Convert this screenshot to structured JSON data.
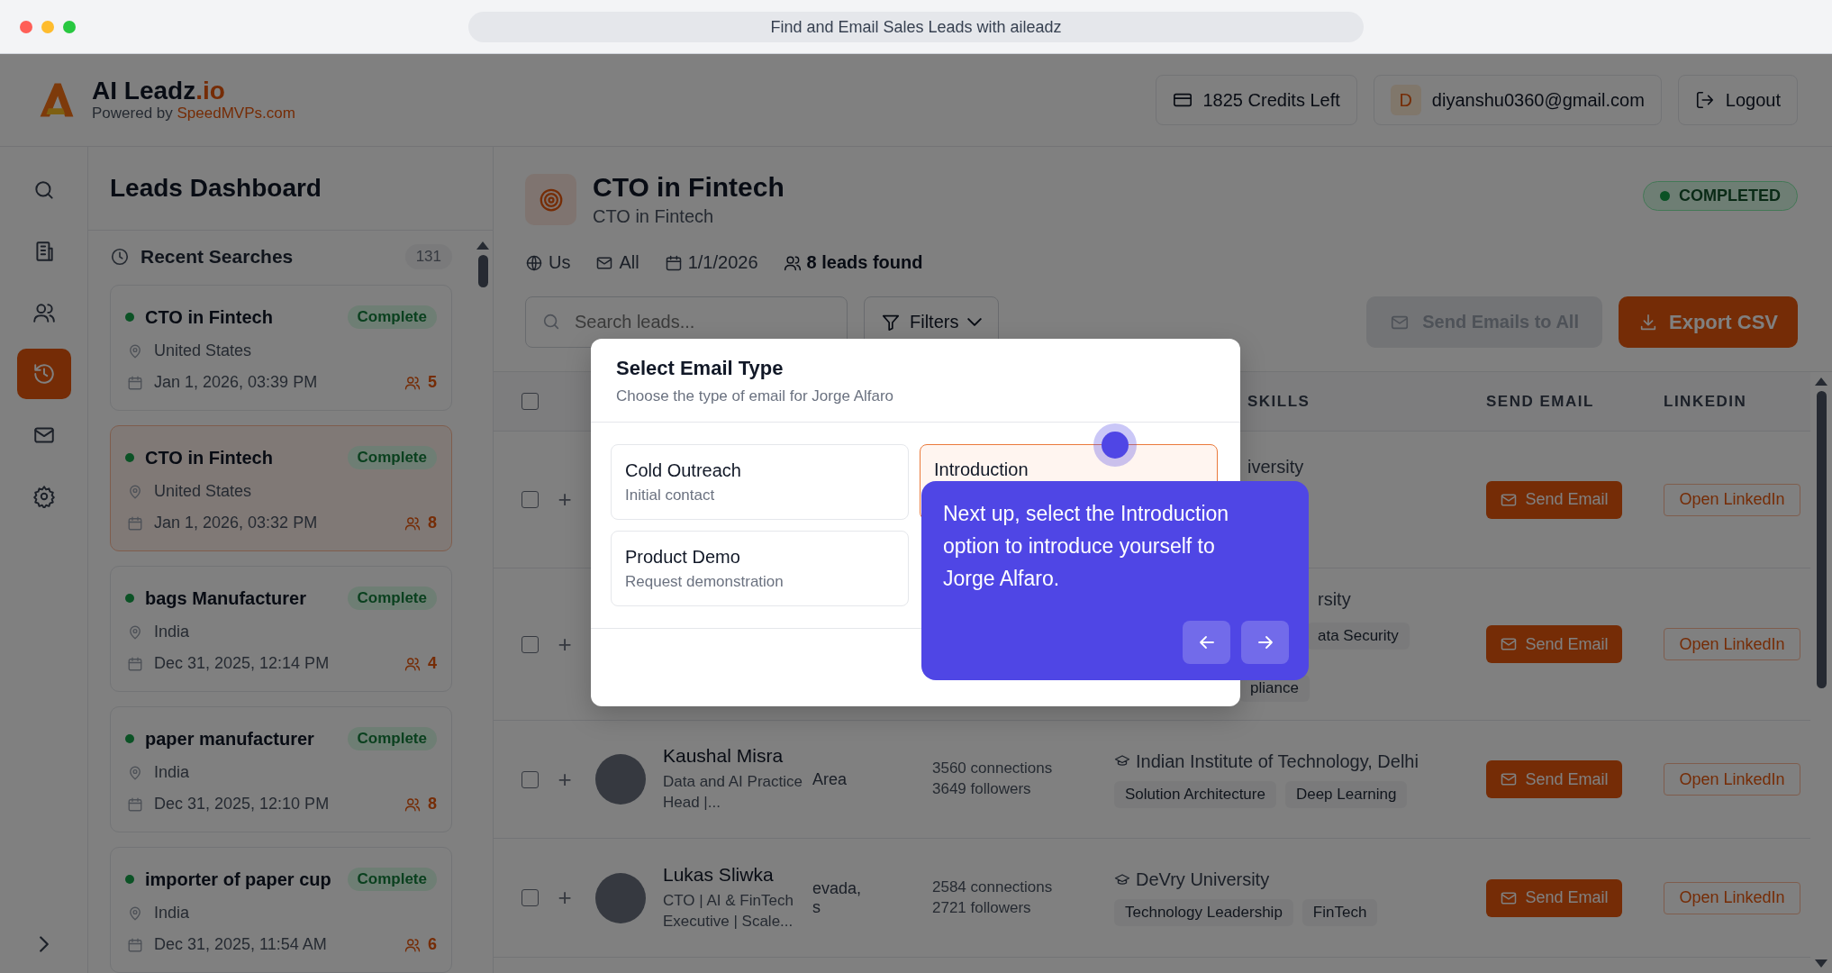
{
  "browser": {
    "title": "Find and Email Sales Leads with aileadz"
  },
  "brand": {
    "name": "AI Leadz",
    "suffix": ".io",
    "tagline": "Powered by",
    "tagline_link": "SpeedMVPs.com"
  },
  "header": {
    "credits": "1825 Credits Left",
    "avatar_initial": "D",
    "email": "diyanshu0360@gmail.com",
    "logout": "Logout"
  },
  "nav": [
    {
      "kind": "search",
      "selected": false
    },
    {
      "kind": "building",
      "selected": false
    },
    {
      "kind": "users",
      "selected": false
    },
    {
      "kind": "history",
      "selected": true
    },
    {
      "kind": "mail",
      "selected": false
    },
    {
      "kind": "settings",
      "selected": false
    }
  ],
  "sidebar": {
    "title": "Leads Dashboard",
    "recent_label": "Recent Searches",
    "recent_count": "131",
    "searches": [
      {
        "title": "CTO in Fintech",
        "status": "Complete",
        "location": "United States",
        "date": "Jan 1, 2026, 03:39 PM",
        "leads": "5",
        "selected": false
      },
      {
        "title": "CTO in Fintech",
        "status": "Complete",
        "location": "United States",
        "date": "Jan 1, 2026, 03:32 PM",
        "leads": "8",
        "selected": true
      },
      {
        "title": "bags Manufacturer",
        "status": "Complete",
        "location": "India",
        "date": "Dec 31, 2025, 12:14 PM",
        "leads": "4",
        "selected": false
      },
      {
        "title": "paper manufacturer",
        "status": "Complete",
        "location": "India",
        "date": "Dec 31, 2025, 12:10 PM",
        "leads": "8",
        "selected": false
      },
      {
        "title": "importer of paper cup",
        "status": "Complete",
        "location": "India",
        "date": "Dec 31, 2025, 11:54 AM",
        "leads": "6",
        "selected": false
      }
    ]
  },
  "search": {
    "title": "CTO in Fintech",
    "subtitle": "CTO in Fintech",
    "status": "COMPLETED",
    "meta": [
      {
        "kind": "globe",
        "text": "Us"
      },
      {
        "kind": "mail",
        "text": "All"
      },
      {
        "kind": "calendar",
        "text": "1/1/2026"
      },
      {
        "kind": "users",
        "text": "8 leads found"
      }
    ]
  },
  "toolbar": {
    "search_placeholder": "Search leads...",
    "filters": "Filters",
    "send_all": {
      "label": "Send Emails to All",
      "disabled": true
    },
    "export": "Export CSV"
  },
  "table": {
    "header_checked": false,
    "columns": [
      {
        "label": "SKILLS"
      },
      {
        "label": "SEND EMAIL"
      },
      {
        "label": "LINKEDIN"
      }
    ],
    "rows": [
      {
        "checked": false,
        "add": "+",
        "education": "iversity",
        "skills": [],
        "send": "Send Email",
        "linkedin": "Open LinkedIn"
      },
      {
        "checked": false,
        "add": "+",
        "education": "rsity",
        "skills": [
          "ata Security",
          "pliance"
        ],
        "send": "Send Email",
        "linkedin": "Open LinkedIn"
      },
      {
        "checked": false,
        "add": "+",
        "name": "Kaushal Misra",
        "headline": "Data and AI Practice Head |...",
        "location": [
          "Area"
        ],
        "connections": "3560 connections",
        "followers": "3649 followers",
        "education": "Indian Institute of Technology, Delhi",
        "skills": [
          "Solution Architecture",
          "Deep Learning"
        ],
        "send": "Send Email",
        "linkedin": "Open LinkedIn"
      },
      {
        "checked": false,
        "add": "+",
        "name": "Lukas Sliwka",
        "headline": "CTO | AI & FinTech Executive | Scale...",
        "location": [
          "evada,",
          "s"
        ],
        "connections": "2584 connections",
        "followers": "2721 followers",
        "education": "DeVry University",
        "skills": [
          "Technology Leadership",
          "FinTech"
        ],
        "send": "Send Email",
        "linkedin": "Open LinkedIn"
      }
    ]
  },
  "modal": {
    "title": "Select Email Type",
    "subtitle": "Choose the type of email for Jorge Alfaro",
    "options": [
      {
        "title": "Cold Outreach",
        "description": "Initial contact",
        "selected": false
      },
      {
        "title": "Introduction",
        "selected": true
      },
      {
        "title": "Product Demo",
        "description": "Request demonstration",
        "selected": false
      }
    ]
  },
  "tour": {
    "text": "Next up, select the Introduction option to introduce yourself to Jorge Alfaro."
  }
}
